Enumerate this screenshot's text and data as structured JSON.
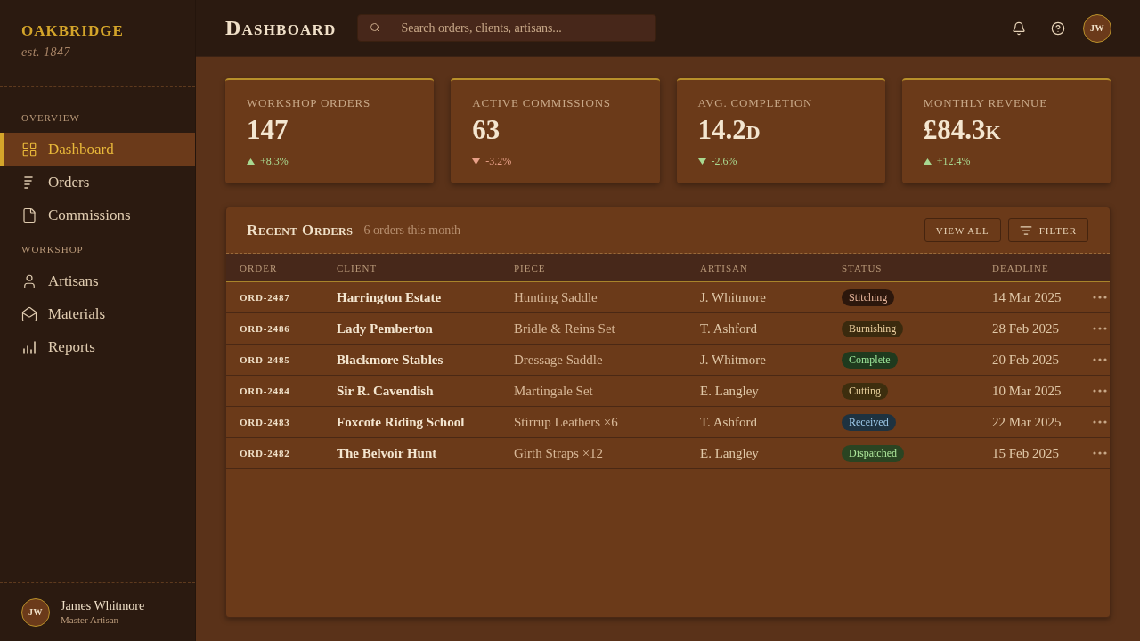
{
  "sidebar": {
    "brand": {
      "name": "OAKBRIDGE",
      "tagline": "est. 1847"
    },
    "sections": [
      {
        "label": "OVERVIEW",
        "items": [
          {
            "label": "Dashboard",
            "selected": true
          },
          {
            "label": "Orders",
            "selected": false
          },
          {
            "label": "Commissions",
            "selected": false
          }
        ]
      },
      {
        "label": "WORKSHOP",
        "items": [
          {
            "label": "Artisans",
            "selected": false
          },
          {
            "label": "Materials",
            "selected": false
          },
          {
            "label": "Reports",
            "selected": false
          }
        ]
      }
    ],
    "user": {
      "initials": "JW",
      "name": "James Whitmore",
      "role": "Master Artisan"
    }
  },
  "header": {
    "title": "Dashboard",
    "search": {
      "placeholder": "Search orders, clients, artisans..."
    },
    "avatar": {
      "initials": "JW"
    }
  },
  "stats": [
    {
      "label": "WORKSHOP ORDERS",
      "value": "147",
      "change": "+8.3%",
      "rising": true,
      "positive": true
    },
    {
      "label": "ACTIVE COMMISSIONS",
      "value": "63",
      "change": "-3.2%",
      "rising": false,
      "positive": false
    },
    {
      "label": "AVG. COMPLETION",
      "value": "14.2d",
      "change": "-2.6%",
      "rising": false,
      "positive": true
    },
    {
      "label": "MONTHLY REVENUE",
      "value": "£84.3k",
      "change": "+12.4%",
      "rising": true,
      "positive": true
    }
  ],
  "orders": {
    "title": "Recent Orders",
    "subtitle": "6 orders this month",
    "buttons": [
      {
        "label": "VIEW ALL",
        "kind": "plain"
      },
      {
        "label": "FILTER",
        "kind": "filter"
      }
    ],
    "columns": [
      "ORDER",
      "CLIENT",
      "PIECE",
      "ARTISAN",
      "STATUS",
      "DEADLINE"
    ],
    "rows": [
      {
        "order": "ORD-2487",
        "client": "Harrington Estate",
        "piece": "Hunting Saddle",
        "artisan": "J. Whitmore",
        "status": {
          "label": "Stitching",
          "color": "#2c170c"
        },
        "deadline": "14 Mar 2025"
      },
      {
        "order": "ORD-2486",
        "client": "Lady Pemberton",
        "piece": "Bridle & Reins Set",
        "artisan": "T. Ashford",
        "status": {
          "label": "Burnishing",
          "color": "#3a2a0e"
        },
        "deadline": "28 Feb 2025"
      },
      {
        "order": "ORD-2485",
        "client": "Blackmore Stables",
        "piece": "Dressage Saddle",
        "artisan": "J. Whitmore",
        "status": {
          "label": "Complete",
          "color": "#1f3a1e"
        },
        "deadline": "20 Feb 2025"
      },
      {
        "order": "ORD-2484",
        "client": "Sir R. Cavendish",
        "piece": "Martingale Set",
        "artisan": "E. Langley",
        "status": {
          "label": "Cutting",
          "color": "#3d2e0e"
        },
        "deadline": "10 Mar 2025"
      },
      {
        "order": "ORD-2483",
        "client": "Foxcote Riding School",
        "piece": "Stirrup Leathers ×6",
        "artisan": "T. Ashford",
        "status": {
          "label": "Received",
          "color": "#1e3240"
        },
        "deadline": "22 Mar 2025"
      },
      {
        "order": "ORD-2482",
        "client": "The Belvoir Hunt",
        "piece": "Girth Straps ×12",
        "artisan": "E. Langley",
        "status": {
          "label": "Dispatched",
          "color": "#2a4422"
        },
        "deadline": "15 Feb 2025"
      }
    ]
  }
}
